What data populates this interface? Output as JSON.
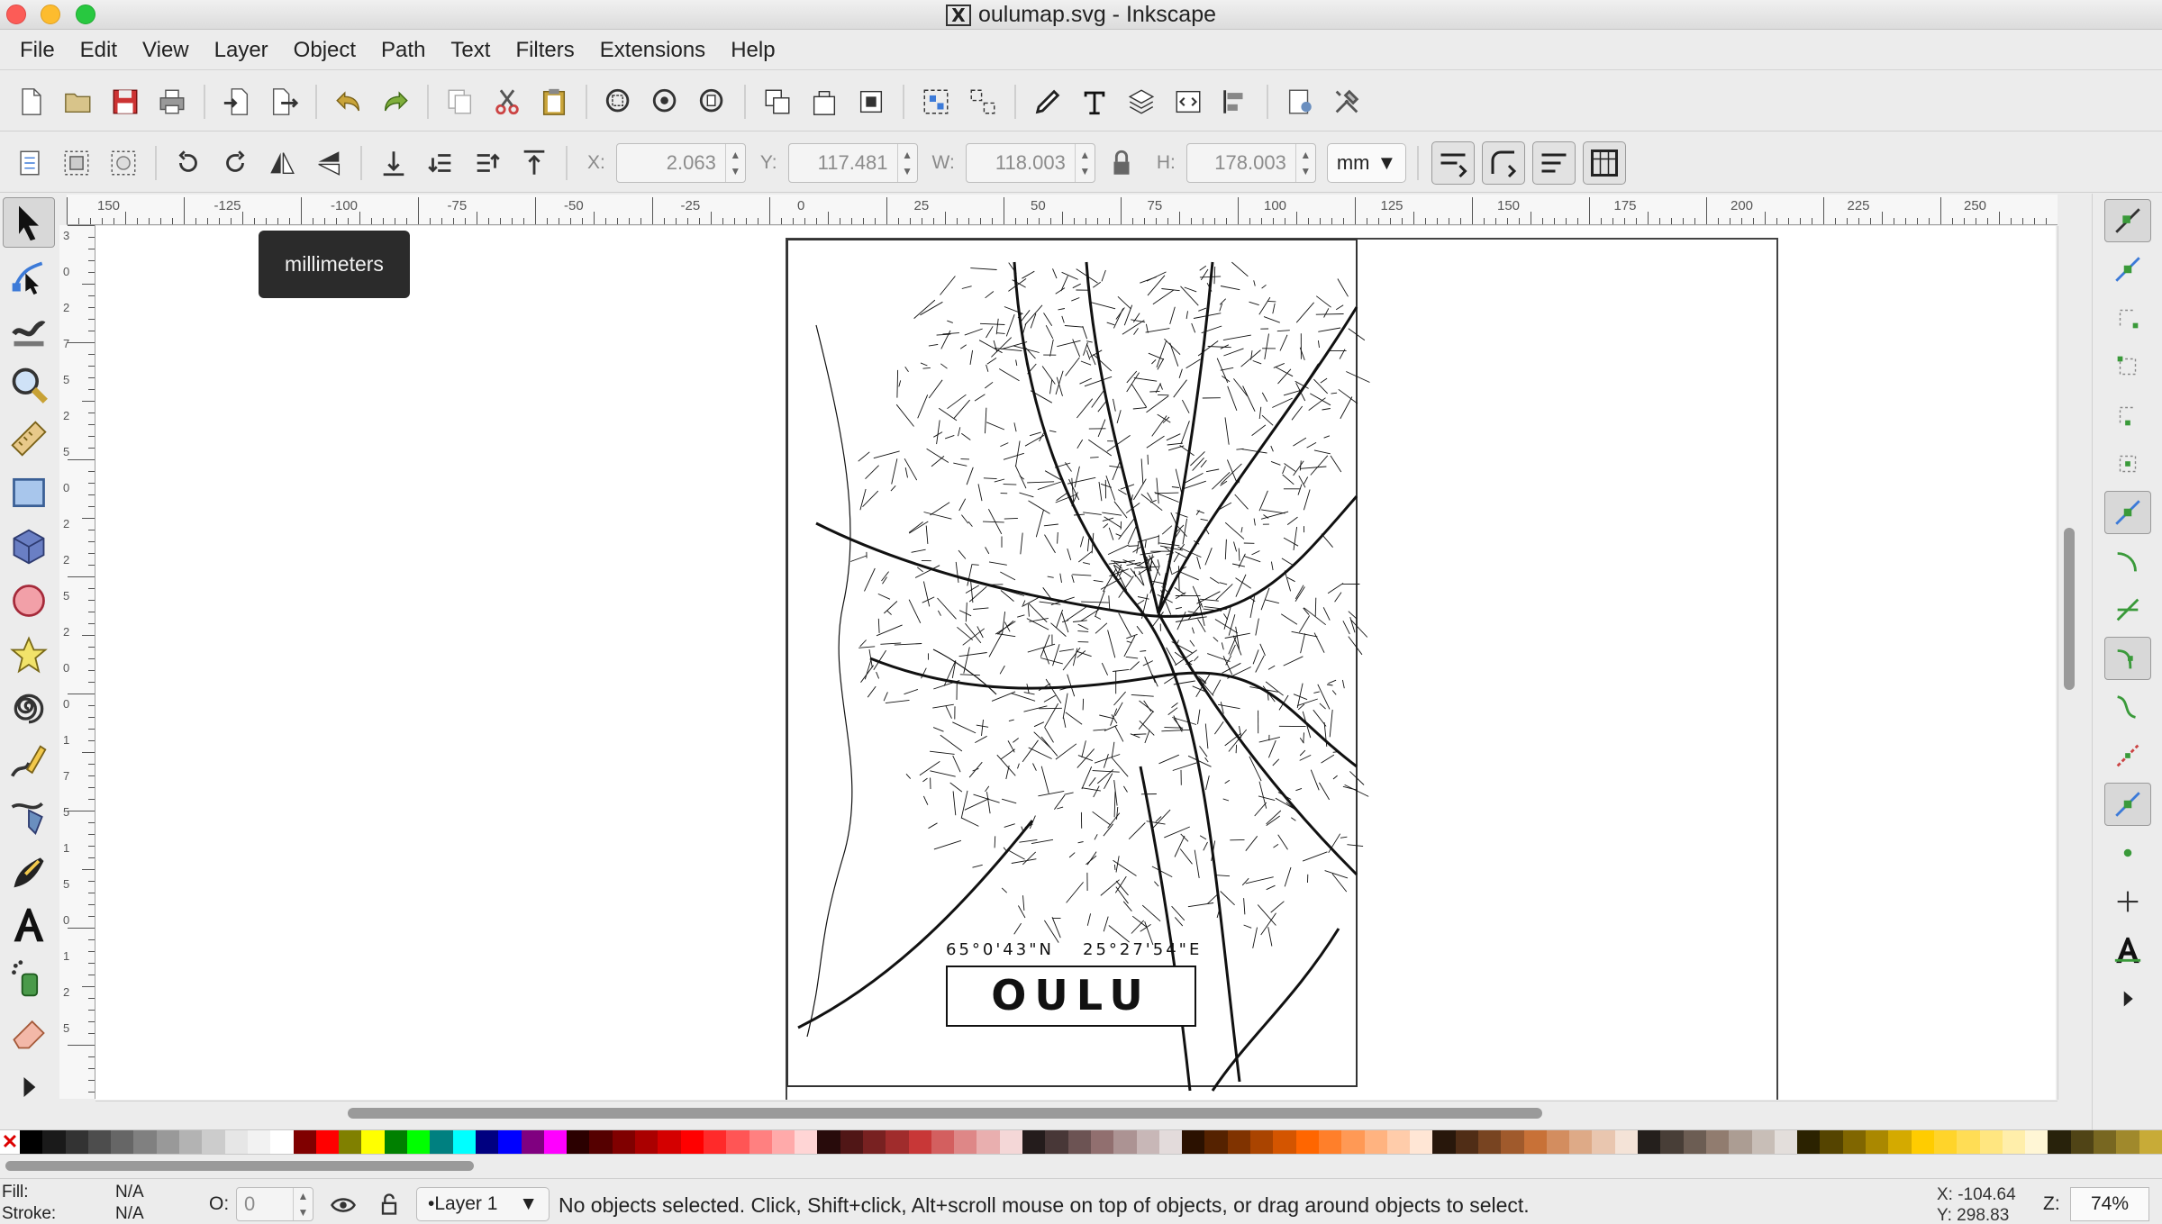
{
  "window": {
    "title": "oulumap.svg - Inkscape"
  },
  "menu": [
    "File",
    "Edit",
    "View",
    "Layer",
    "Object",
    "Path",
    "Text",
    "Filters",
    "Extensions",
    "Help"
  ],
  "controls": {
    "x_label": "X:",
    "x_value": "2.063",
    "y_label": "Y:",
    "y_value": "117.481",
    "w_label": "W:",
    "w_value": "118.003",
    "h_label": "H:",
    "h_value": "178.003",
    "unit": "mm"
  },
  "ruler": {
    "top_labels": [
      "150",
      "-125",
      "-100",
      "-75",
      "-50",
      "-25",
      "0",
      "25",
      "50",
      "75",
      "100",
      "125",
      "150",
      "175",
      "200",
      "225",
      "250"
    ],
    "left_labels": [
      "3",
      "0",
      "2",
      "7",
      "5",
      "2",
      "5",
      "0",
      "2",
      "2",
      "5",
      "2",
      "0",
      "0",
      "1",
      "7",
      "5",
      "1",
      "5",
      "0",
      "1",
      "2",
      "5"
    ]
  },
  "tooltip": {
    "text": "millimeters"
  },
  "map": {
    "coordinates_lat": "65°0'43\"N",
    "coordinates_lon": "25°27'54\"E",
    "city": "OULU"
  },
  "colors": {
    "accent": "#3c7ad8",
    "map_ink": "#111111"
  },
  "status": {
    "fill_label": "Fill:",
    "fill_value": "N/A",
    "stroke_label": "Stroke:",
    "stroke_value": "N/A",
    "opacity_label": "O:",
    "opacity_value": "0",
    "layer": "•Layer 1",
    "message": "No objects selected. Click, Shift+click, Alt+scroll mouse on top of objects, or drag around objects to select.",
    "cursor_x": "X: -104.64",
    "cursor_y": "Y:  298.83",
    "zoom_label": "Z:",
    "zoom": "74%"
  }
}
